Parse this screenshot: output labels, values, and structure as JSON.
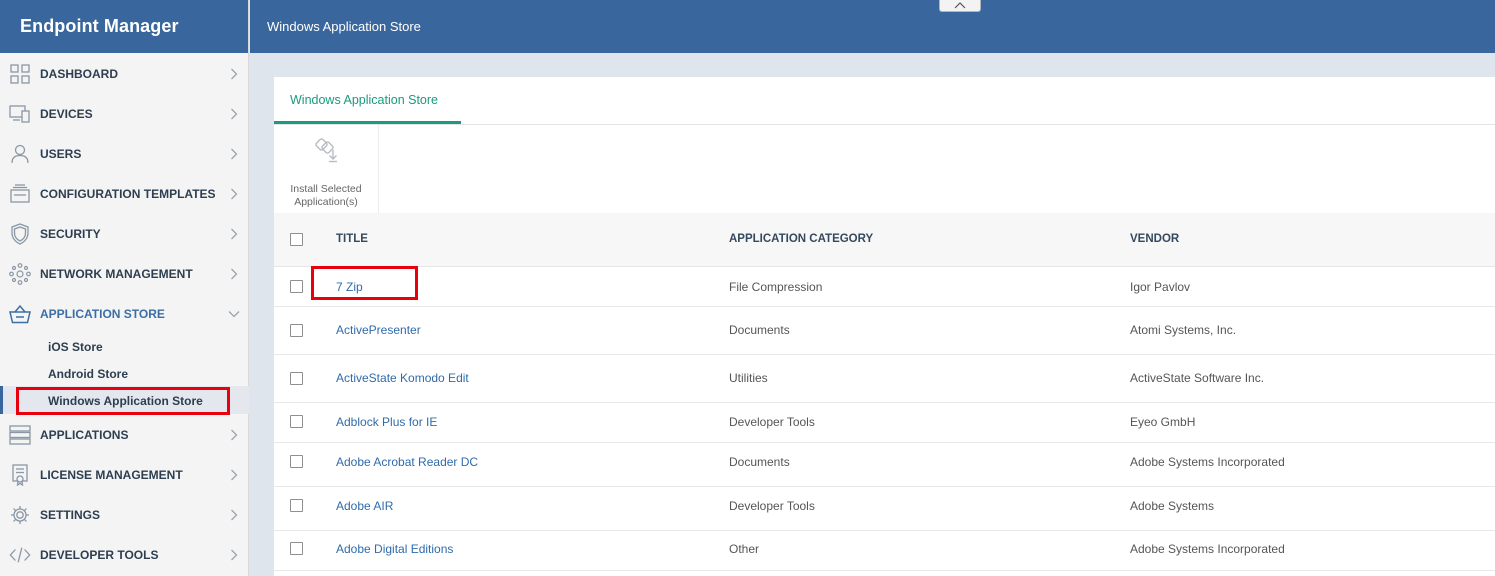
{
  "sidebar": {
    "brand": "Endpoint Manager",
    "items": [
      {
        "label": "DASHBOARD",
        "icon": "dashboard-grid-icon"
      },
      {
        "label": "DEVICES",
        "icon": "devices-icon"
      },
      {
        "label": "USERS",
        "icon": "user-icon"
      },
      {
        "label": "CONFIGURATION TEMPLATES",
        "icon": "templates-icon"
      },
      {
        "label": "SECURITY",
        "icon": "shield-icon"
      },
      {
        "label": "NETWORK MANAGEMENT",
        "icon": "network-icon"
      },
      {
        "label": "APPLICATION STORE",
        "icon": "basket-icon",
        "expanded": true
      },
      {
        "label": "APPLICATIONS",
        "icon": "applications-icon"
      },
      {
        "label": "LICENSE MANAGEMENT",
        "icon": "license-icon"
      },
      {
        "label": "SETTINGS",
        "icon": "gear-icon"
      },
      {
        "label": "DEVELOPER TOOLS",
        "icon": "code-icon"
      }
    ],
    "sub_items": [
      "iOS Store",
      "Android Store",
      "Windows Application Store"
    ],
    "active_sub_item": "Windows Application Store"
  },
  "header": {
    "title": "Windows Application Store"
  },
  "main": {
    "tab_label": "Windows Application Store",
    "toolbar": {
      "install_label_line1": "Install Selected",
      "install_label_line2": "Application(s)"
    },
    "table": {
      "columns": [
        "TITLE",
        "APPLICATION CATEGORY",
        "VENDOR"
      ],
      "rows": [
        {
          "title": "7 Zip",
          "category": "File Compression",
          "vendor": "Igor Pavlov"
        },
        {
          "title": "ActivePresenter",
          "category": "Documents",
          "vendor": "Atomi Systems, Inc."
        },
        {
          "title": "ActiveState Komodo Edit",
          "category": "Utilities",
          "vendor": "ActiveState Software Inc."
        },
        {
          "title": "Adblock Plus for IE",
          "category": "Developer Tools",
          "vendor": "Eyeo GmbH"
        },
        {
          "title": "Adobe Acrobat Reader DC",
          "category": "Documents",
          "vendor": "Adobe Systems Incorporated"
        },
        {
          "title": "Adobe AIR",
          "category": "Developer Tools",
          "vendor": "Adobe Systems"
        },
        {
          "title": "Adobe Digital Editions",
          "category": "Other",
          "vendor": "Adobe Systems Incorporated"
        }
      ]
    }
  },
  "colors": {
    "header_blue": "#39679d",
    "accent_green": "#1a9a7e",
    "link_blue": "#2f6bab",
    "highlight_red": "#e8000d"
  }
}
